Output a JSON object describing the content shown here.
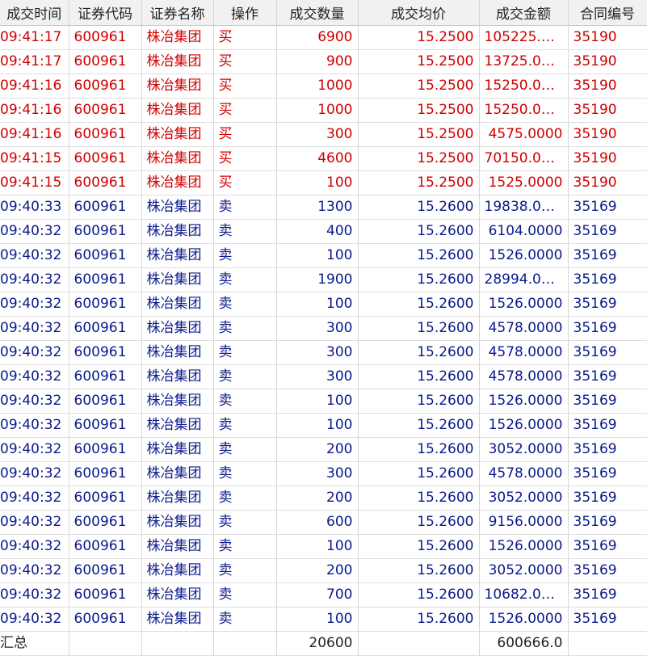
{
  "columns": [
    "成交时间",
    "证券代码",
    "证券名称",
    "操作",
    "成交数量",
    "成交均价",
    "成交金额",
    "合同编号"
  ],
  "colors": {
    "buy": "#d00000",
    "sell": "#0a1a8c",
    "header_bg": "#f1f1f1"
  },
  "rows": [
    {
      "side": "buy",
      "time": "09:41:17",
      "code": "600961",
      "name": "株冶集团",
      "action": "买",
      "qty": "6900",
      "price": "15.2500",
      "amount": "105225.0...",
      "contract": "35190"
    },
    {
      "side": "buy",
      "time": "09:41:17",
      "code": "600961",
      "name": "株冶集团",
      "action": "买",
      "qty": "900",
      "price": "15.2500",
      "amount": "13725.000...",
      "contract": "35190"
    },
    {
      "side": "buy",
      "time": "09:41:16",
      "code": "600961",
      "name": "株冶集团",
      "action": "买",
      "qty": "1000",
      "price": "15.2500",
      "amount": "15250.000...",
      "contract": "35190"
    },
    {
      "side": "buy",
      "time": "09:41:16",
      "code": "600961",
      "name": "株冶集团",
      "action": "买",
      "qty": "1000",
      "price": "15.2500",
      "amount": "15250.000...",
      "contract": "35190"
    },
    {
      "side": "buy",
      "time": "09:41:16",
      "code": "600961",
      "name": "株冶集团",
      "action": "买",
      "qty": "300",
      "price": "15.2500",
      "amount": "4575.0000",
      "contract": "35190"
    },
    {
      "side": "buy",
      "time": "09:41:15",
      "code": "600961",
      "name": "株冶集团",
      "action": "买",
      "qty": "4600",
      "price": "15.2500",
      "amount": "70150.000...",
      "contract": "35190"
    },
    {
      "side": "buy",
      "time": "09:41:15",
      "code": "600961",
      "name": "株冶集团",
      "action": "买",
      "qty": "100",
      "price": "15.2500",
      "amount": "1525.0000",
      "contract": "35190"
    },
    {
      "side": "sell",
      "time": "09:40:33",
      "code": "600961",
      "name": "株冶集团",
      "action": "卖",
      "qty": "1300",
      "price": "15.2600",
      "amount": "19838.000...",
      "contract": "35169"
    },
    {
      "side": "sell",
      "time": "09:40:32",
      "code": "600961",
      "name": "株冶集团",
      "action": "卖",
      "qty": "400",
      "price": "15.2600",
      "amount": "6104.0000",
      "contract": "35169"
    },
    {
      "side": "sell",
      "time": "09:40:32",
      "code": "600961",
      "name": "株冶集团",
      "action": "卖",
      "qty": "100",
      "price": "15.2600",
      "amount": "1526.0000",
      "contract": "35169"
    },
    {
      "side": "sell",
      "time": "09:40:32",
      "code": "600961",
      "name": "株冶集团",
      "action": "卖",
      "qty": "1900",
      "price": "15.2600",
      "amount": "28994.000...",
      "contract": "35169"
    },
    {
      "side": "sell",
      "time": "09:40:32",
      "code": "600961",
      "name": "株冶集团",
      "action": "卖",
      "qty": "100",
      "price": "15.2600",
      "amount": "1526.0000",
      "contract": "35169"
    },
    {
      "side": "sell",
      "time": "09:40:32",
      "code": "600961",
      "name": "株冶集团",
      "action": "卖",
      "qty": "300",
      "price": "15.2600",
      "amount": "4578.0000",
      "contract": "35169"
    },
    {
      "side": "sell",
      "time": "09:40:32",
      "code": "600961",
      "name": "株冶集团",
      "action": "卖",
      "qty": "300",
      "price": "15.2600",
      "amount": "4578.0000",
      "contract": "35169"
    },
    {
      "side": "sell",
      "time": "09:40:32",
      "code": "600961",
      "name": "株冶集团",
      "action": "卖",
      "qty": "300",
      "price": "15.2600",
      "amount": "4578.0000",
      "contract": "35169"
    },
    {
      "side": "sell",
      "time": "09:40:32",
      "code": "600961",
      "name": "株冶集团",
      "action": "卖",
      "qty": "100",
      "price": "15.2600",
      "amount": "1526.0000",
      "contract": "35169"
    },
    {
      "side": "sell",
      "time": "09:40:32",
      "code": "600961",
      "name": "株冶集团",
      "action": "卖",
      "qty": "100",
      "price": "15.2600",
      "amount": "1526.0000",
      "contract": "35169"
    },
    {
      "side": "sell",
      "time": "09:40:32",
      "code": "600961",
      "name": "株冶集团",
      "action": "卖",
      "qty": "200",
      "price": "15.2600",
      "amount": "3052.0000",
      "contract": "35169"
    },
    {
      "side": "sell",
      "time": "09:40:32",
      "code": "600961",
      "name": "株冶集团",
      "action": "卖",
      "qty": "300",
      "price": "15.2600",
      "amount": "4578.0000",
      "contract": "35169"
    },
    {
      "side": "sell",
      "time": "09:40:32",
      "code": "600961",
      "name": "株冶集团",
      "action": "卖",
      "qty": "200",
      "price": "15.2600",
      "amount": "3052.0000",
      "contract": "35169"
    },
    {
      "side": "sell",
      "time": "09:40:32",
      "code": "600961",
      "name": "株冶集团",
      "action": "卖",
      "qty": "600",
      "price": "15.2600",
      "amount": "9156.0000",
      "contract": "35169"
    },
    {
      "side": "sell",
      "time": "09:40:32",
      "code": "600961",
      "name": "株冶集团",
      "action": "卖",
      "qty": "100",
      "price": "15.2600",
      "amount": "1526.0000",
      "contract": "35169"
    },
    {
      "side": "sell",
      "time": "09:40:32",
      "code": "600961",
      "name": "株冶集团",
      "action": "卖",
      "qty": "200",
      "price": "15.2600",
      "amount": "3052.0000",
      "contract": "35169"
    },
    {
      "side": "sell",
      "time": "09:40:32",
      "code": "600961",
      "name": "株冶集团",
      "action": "卖",
      "qty": "700",
      "price": "15.2600",
      "amount": "10682.000...",
      "contract": "35169"
    },
    {
      "side": "sell",
      "time": "09:40:32",
      "code": "600961",
      "name": "株冶集团",
      "action": "卖",
      "qty": "100",
      "price": "15.2600",
      "amount": "1526.0000",
      "contract": "35169"
    }
  ],
  "summary": {
    "label": "汇总",
    "qty": "20600",
    "amount": "600666.0"
  }
}
